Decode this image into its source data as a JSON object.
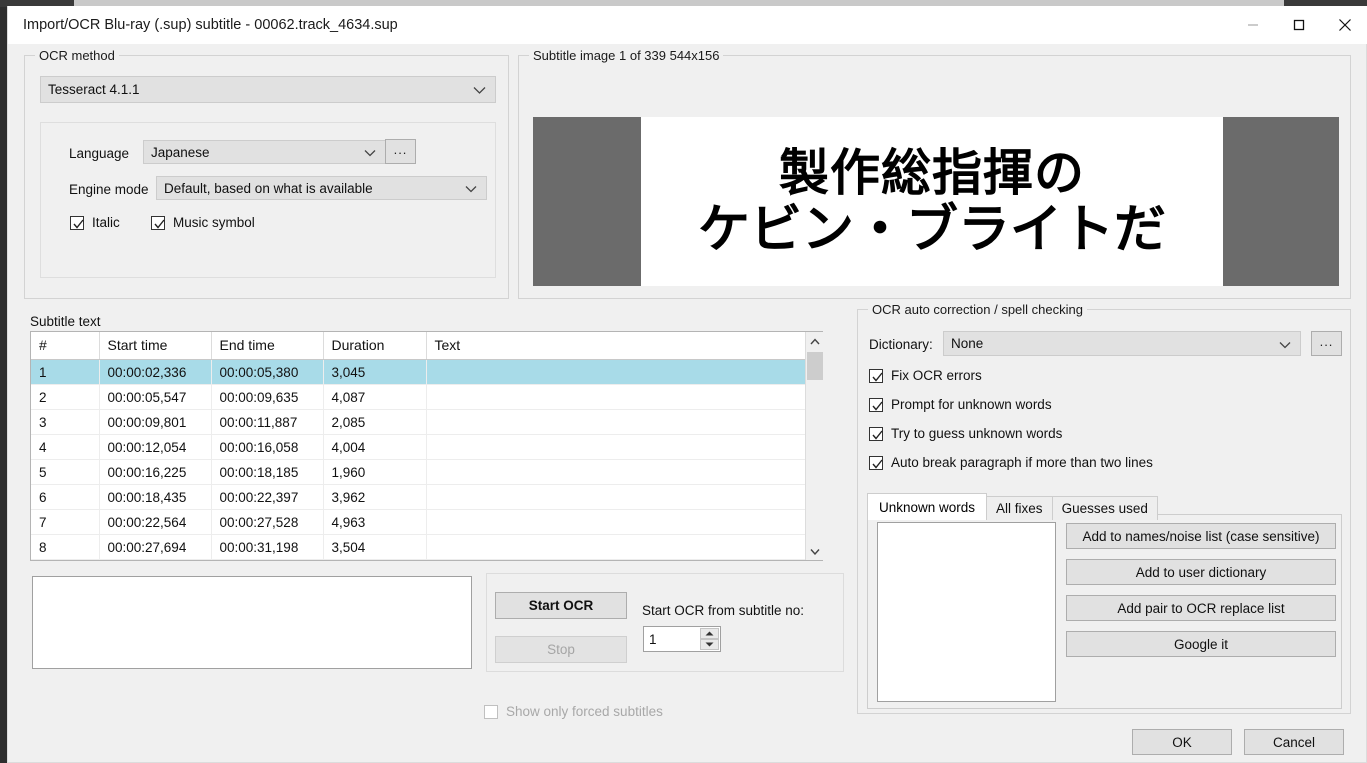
{
  "window": {
    "title": "Import/OCR Blu-ray (.sup) subtitle - 00062.track_4634.sup",
    "minimize_label": "—",
    "maximize_label": "□",
    "close_label": "✕"
  },
  "ocr_method": {
    "group_label": "OCR method",
    "engine_value": "Tesseract 4.1.1",
    "language_label": "Language",
    "language_value": "Japanese",
    "language_browse_label": "...",
    "engine_mode_label": "Engine mode",
    "engine_mode_value": "Default, based on what is available",
    "italic_label": "Italic",
    "italic_checked": true,
    "music_symbol_label": "Music symbol",
    "music_symbol_checked": true
  },
  "preview": {
    "group_label": "Subtitle image 1 of 339   544x156",
    "image_line1": "製作総指揮の",
    "image_line2": "ケビン・ブライトだ"
  },
  "subtitle_text": {
    "group_label": "Subtitle text",
    "columns": [
      "#",
      "Start time",
      "End time",
      "Duration",
      "Text"
    ],
    "rows": [
      {
        "num": "1",
        "start": "00:00:02,336",
        "end": "00:00:05,380",
        "duration": "3,045",
        "text": "",
        "selected": true
      },
      {
        "num": "2",
        "start": "00:00:05,547",
        "end": "00:00:09,635",
        "duration": "4,087",
        "text": "",
        "selected": false
      },
      {
        "num": "3",
        "start": "00:00:09,801",
        "end": "00:00:11,887",
        "duration": "2,085",
        "text": "",
        "selected": false
      },
      {
        "num": "4",
        "start": "00:00:12,054",
        "end": "00:00:16,058",
        "duration": "4,004",
        "text": "",
        "selected": false
      },
      {
        "num": "5",
        "start": "00:00:16,225",
        "end": "00:00:18,185",
        "duration": "1,960",
        "text": "",
        "selected": false
      },
      {
        "num": "6",
        "start": "00:00:18,435",
        "end": "00:00:22,397",
        "duration": "3,962",
        "text": "",
        "selected": false
      },
      {
        "num": "7",
        "start": "00:00:22,564",
        "end": "00:00:27,528",
        "duration": "4,963",
        "text": "",
        "selected": false
      },
      {
        "num": "8",
        "start": "00:00:27,694",
        "end": "00:00:31,198",
        "duration": "3,504",
        "text": "",
        "selected": false
      }
    ]
  },
  "log": {
    "value": ""
  },
  "actions": {
    "start_ocr_label": "Start OCR",
    "stop_label": "Stop",
    "start_from_label": "Start OCR from subtitle no:",
    "start_from_value": "1",
    "show_only_forced_label": "Show only forced subtitles",
    "show_only_forced_checked": false
  },
  "autocorrect": {
    "group_label": "OCR auto correction / spell checking",
    "dictionary_label": "Dictionary:",
    "dictionary_value": "None",
    "dictionary_browse_label": "...",
    "checkboxes": [
      {
        "label": "Fix OCR errors",
        "checked": true
      },
      {
        "label": "Prompt for unknown words",
        "checked": true
      },
      {
        "label": "Try to guess unknown words",
        "checked": true
      },
      {
        "label": "Auto break paragraph if more than two lines",
        "checked": true
      }
    ],
    "tabs": [
      {
        "label": "Unknown words",
        "active": true
      },
      {
        "label": "All fixes",
        "active": false
      },
      {
        "label": "Guesses used",
        "active": false
      }
    ],
    "word_list": "",
    "buttons": [
      "Add to names/noise list (case sensitive)",
      "Add to user dictionary",
      "Add pair to OCR replace list",
      "Google it"
    ]
  },
  "footer": {
    "ok_label": "OK",
    "cancel_label": "Cancel"
  },
  "colors": {
    "selection": "#a8dbe8",
    "dialog_bg": "#f0f0f0",
    "control_bg": "#e1e1e1",
    "preview_bar": "#6b6b6b"
  }
}
